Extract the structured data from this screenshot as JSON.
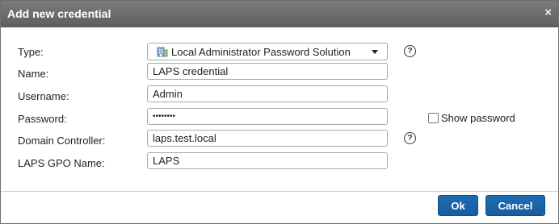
{
  "dialog": {
    "title": "Add new credential",
    "close_icon": "×"
  },
  "form": {
    "type_label": "Type:",
    "type_value": "Local Administrator Password Solution",
    "type_icon": "building-icon",
    "name_label": "Name:",
    "name_value": "LAPS credential",
    "username_label": "Username:",
    "username_value": "Admin",
    "password_label": "Password:",
    "password_value": "••••••••",
    "show_password_label": "Show password",
    "domain_controller_label": "Domain Controller:",
    "domain_controller_value": "laps.test.local",
    "laps_gpo_label": "LAPS GPO Name:",
    "laps_gpo_value": "LAPS",
    "help_glyph": "?"
  },
  "buttons": {
    "ok": "Ok",
    "cancel": "Cancel"
  },
  "colors": {
    "titlebar": "#6b6b6b",
    "button": "#1b65a8",
    "icon_blue": "#5a7fb0",
    "icon_green": "#5e9b5b"
  }
}
